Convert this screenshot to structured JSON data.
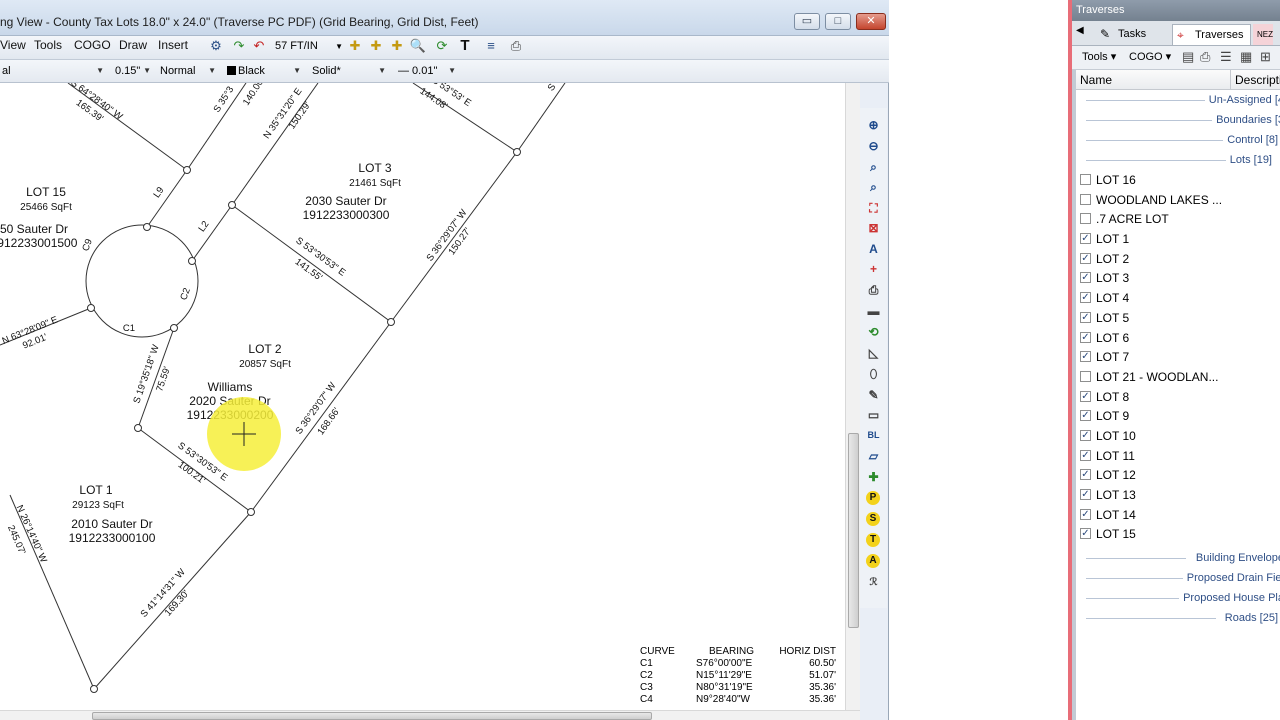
{
  "window": {
    "title": "ng View - County Tax Lots  18.0\" x 24.0\" (Traverse PC PDF) (Grid Bearing, Grid Dist, Feet)",
    "minimize": "▭",
    "maximize": "□",
    "close": "✕"
  },
  "menu": [
    "View",
    "Tools",
    "COGO",
    "Draw",
    "Insert"
  ],
  "toolbar": {
    "scale": "57 FT/IN"
  },
  "properties": {
    "layer": "al",
    "line_width": "0.15\"",
    "style": "Normal",
    "color": "Black",
    "line_type": "Solid*",
    "line_scale": "— 0.01\""
  },
  "drawing": {
    "lots": [
      {
        "name": "LOT 15",
        "area": "25466 SqFt",
        "address": "50 Sauter Dr",
        "parcel": "1912233001500"
      },
      {
        "name": "LOT 3",
        "area": "21461 SqFt",
        "address": "2030 Sauter Dr",
        "parcel": "1912233000300"
      },
      {
        "name": "LOT 2",
        "area": "20857 SqFt",
        "owner": "Williams",
        "address": "2020 Sauter Dr",
        "parcel": "1912233000200"
      },
      {
        "name": "LOT 1",
        "area": "29123 SqFt",
        "address": "2010 Sauter Dr",
        "parcel": "1912233000100"
      }
    ],
    "bearings": {
      "b1": "S 64°28'40\" W",
      "d1": "165.39'",
      "b2": "S 35°3",
      "d2": "140.00'",
      "b3": "N 35°31'20\" E",
      "d3": "150.29'",
      "b4": "S 53°53' E",
      "d4": "144.08'",
      "b5": "S 53°30'53\" E",
      "d5": "141.55'",
      "b6": "S 36°29'07\" W",
      "d6": "150.27'",
      "b7": "S 36°29'07\" W",
      "d7": "168.66'",
      "b8": "S 53°30'53\" E",
      "d8": "100.21'",
      "b9": "S 19°35'18\" W",
      "d9": "75.59'",
      "b10": "N 63°28'09\" E",
      "d10": "92.01'",
      "b11": "N 26°14'40\" W",
      "d11": "245.07'",
      "b12": "S 41°14'31\" W",
      "d12": "169.30'",
      "s_edge": "S",
      "L9": "L9",
      "L2": "L2",
      "C9": "C9",
      "C2": "C2",
      "C1": "C1"
    },
    "curve_table": {
      "headers": [
        "CURVE",
        "BEARING",
        "HORIZ DIST"
      ],
      "rows": [
        [
          "C1",
          "S76°00'00\"E",
          "60.50'"
        ],
        [
          "C2",
          "N15°11'29\"E",
          "51.07'"
        ],
        [
          "C3",
          "N80°31'19\"E",
          "35.36'"
        ],
        [
          "C4",
          "N9°28'40\"W",
          "35.36'"
        ]
      ]
    }
  },
  "right_panel": {
    "title": "Traverses",
    "tabs": [
      "Tasks",
      "Traverses",
      "NEZ"
    ],
    "toolbar": [
      "Tools",
      "COGO"
    ],
    "columns": [
      "Name",
      "Descripti"
    ],
    "groups_top": [
      "Un-Assigned [4",
      "Boundaries [3",
      "Control [8]",
      "Lots [19]"
    ],
    "lots": [
      {
        "name": "LOT 16",
        "checked": false
      },
      {
        "name": "WOODLAND LAKES ...",
        "checked": false
      },
      {
        "name": ".7 ACRE LOT",
        "checked": false
      },
      {
        "name": "LOT 1",
        "checked": true
      },
      {
        "name": "LOT 2",
        "checked": true
      },
      {
        "name": "LOT 3",
        "checked": true
      },
      {
        "name": "LOT 4",
        "checked": true
      },
      {
        "name": "LOT 5",
        "checked": true
      },
      {
        "name": "LOT 6",
        "checked": true
      },
      {
        "name": "LOT 7",
        "checked": true
      },
      {
        "name": "LOT 21 - WOODLAN...",
        "checked": false
      },
      {
        "name": "LOT 8",
        "checked": true
      },
      {
        "name": "LOT 9",
        "checked": true
      },
      {
        "name": "LOT 10",
        "checked": true
      },
      {
        "name": "LOT 11",
        "checked": true
      },
      {
        "name": "LOT 12",
        "checked": true
      },
      {
        "name": "LOT 13",
        "checked": true
      },
      {
        "name": "LOT 14",
        "checked": true
      },
      {
        "name": "LOT 15",
        "checked": true
      }
    ],
    "groups_bottom": [
      "Building Envelope",
      "Proposed Drain Fiel",
      "Proposed House Pla",
      "Roads [25]"
    ]
  }
}
